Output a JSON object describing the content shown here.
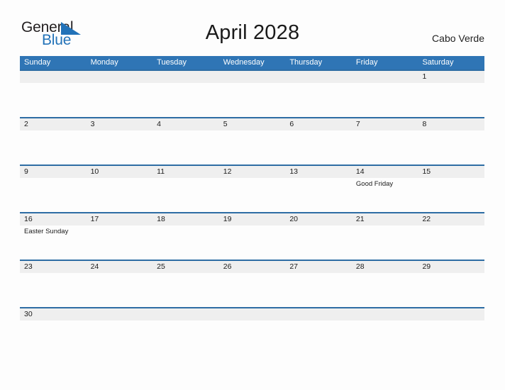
{
  "header": {
    "logo": {
      "text_primary": "General",
      "text_secondary": "Blue",
      "icon": "blue-triangle-icon",
      "primary_color": "#231f20",
      "secondary_color": "#2272b8"
    },
    "title": "April 2028",
    "country": "Cabo Verde"
  },
  "colors": {
    "header_band": "#2f75b5",
    "rule": "#2e6da4",
    "date_strip": "#efefef",
    "page_background": "#fdfdfd",
    "text": "#1a1a1a"
  },
  "calendar": {
    "month": "April",
    "year": "2028",
    "weekdays": [
      "Sunday",
      "Monday",
      "Tuesday",
      "Wednesday",
      "Thursday",
      "Friday",
      "Saturday"
    ],
    "weeks": [
      {
        "days": [
          {
            "date": "",
            "event": ""
          },
          {
            "date": "",
            "event": ""
          },
          {
            "date": "",
            "event": ""
          },
          {
            "date": "",
            "event": ""
          },
          {
            "date": "",
            "event": ""
          },
          {
            "date": "",
            "event": ""
          },
          {
            "date": "1",
            "event": ""
          }
        ]
      },
      {
        "days": [
          {
            "date": "2",
            "event": ""
          },
          {
            "date": "3",
            "event": ""
          },
          {
            "date": "4",
            "event": ""
          },
          {
            "date": "5",
            "event": ""
          },
          {
            "date": "6",
            "event": ""
          },
          {
            "date": "7",
            "event": ""
          },
          {
            "date": "8",
            "event": ""
          }
        ]
      },
      {
        "days": [
          {
            "date": "9",
            "event": ""
          },
          {
            "date": "10",
            "event": ""
          },
          {
            "date": "11",
            "event": ""
          },
          {
            "date": "12",
            "event": ""
          },
          {
            "date": "13",
            "event": ""
          },
          {
            "date": "14",
            "event": "Good Friday"
          },
          {
            "date": "15",
            "event": ""
          }
        ]
      },
      {
        "days": [
          {
            "date": "16",
            "event": "Easter Sunday"
          },
          {
            "date": "17",
            "event": ""
          },
          {
            "date": "18",
            "event": ""
          },
          {
            "date": "19",
            "event": ""
          },
          {
            "date": "20",
            "event": ""
          },
          {
            "date": "21",
            "event": ""
          },
          {
            "date": "22",
            "event": ""
          }
        ]
      },
      {
        "days": [
          {
            "date": "23",
            "event": ""
          },
          {
            "date": "24",
            "event": ""
          },
          {
            "date": "25",
            "event": ""
          },
          {
            "date": "26",
            "event": ""
          },
          {
            "date": "27",
            "event": ""
          },
          {
            "date": "28",
            "event": ""
          },
          {
            "date": "29",
            "event": ""
          }
        ]
      },
      {
        "days": [
          {
            "date": "30",
            "event": ""
          },
          {
            "date": "",
            "event": ""
          },
          {
            "date": "",
            "event": ""
          },
          {
            "date": "",
            "event": ""
          },
          {
            "date": "",
            "event": ""
          },
          {
            "date": "",
            "event": ""
          },
          {
            "date": "",
            "event": ""
          }
        ]
      }
    ]
  }
}
